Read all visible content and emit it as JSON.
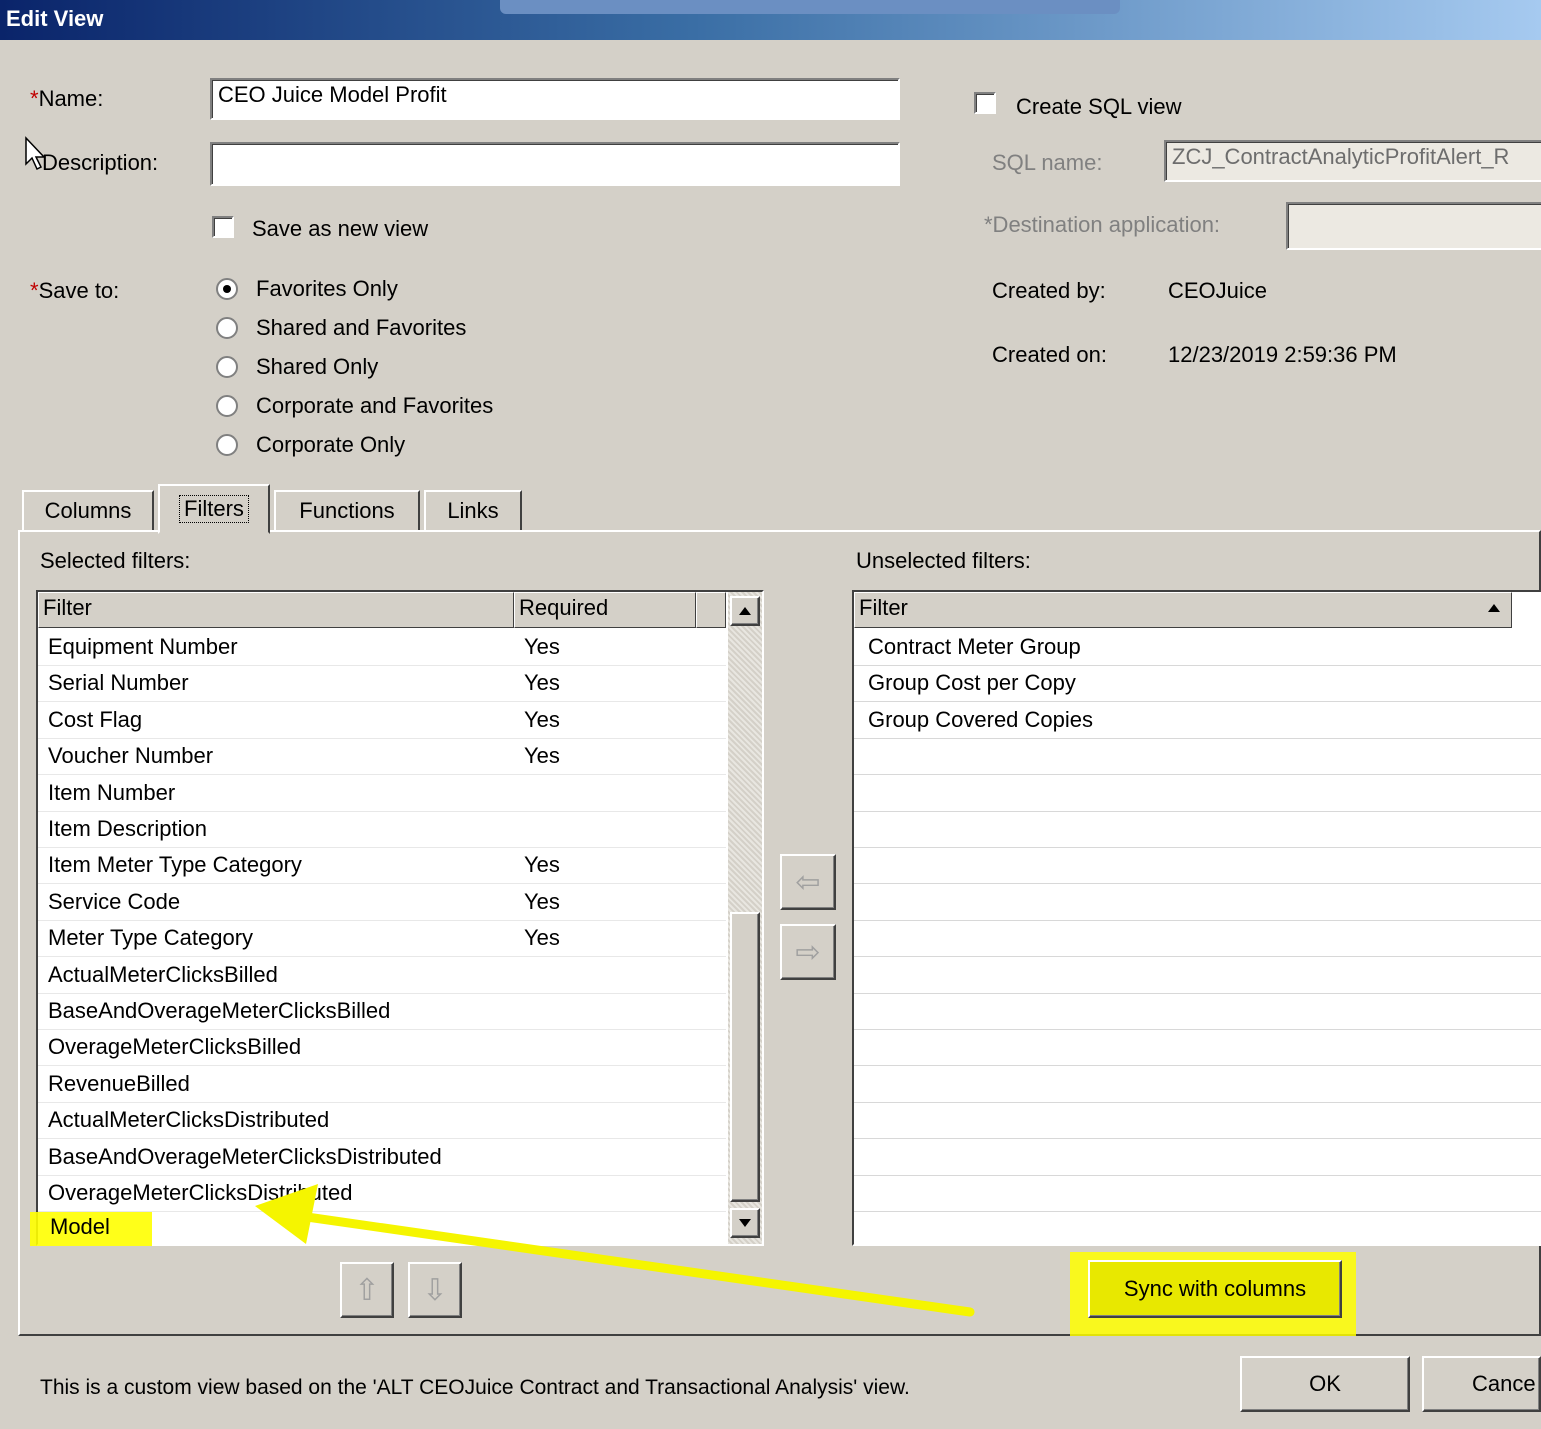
{
  "window": {
    "title": "Edit View"
  },
  "form": {
    "name_label": "Name:",
    "name_value": "CEO Juice Model Profit",
    "description_label": "Description:",
    "description_value": "",
    "save_as_new_label": "Save as new view",
    "save_to_label": "Save to:",
    "required_marker": "*",
    "save_to_options": [
      {
        "label": "Favorites Only",
        "selected": true
      },
      {
        "label": "Shared and Favorites",
        "selected": false
      },
      {
        "label": "Shared Only",
        "selected": false
      },
      {
        "label": "Corporate and Favorites",
        "selected": false
      },
      {
        "label": "Corporate Only",
        "selected": false
      }
    ]
  },
  "sql": {
    "create_label": "Create SQL view",
    "sql_name_label": "SQL name:",
    "sql_name_value": "ZCJ_ContractAnalyticProfitAlert_R",
    "dest_app_label": "*Destination application:",
    "dest_app_value": "",
    "created_by_label": "Created by:",
    "created_by_value": "CEOJuice",
    "created_on_label": "Created on:",
    "created_on_value": "12/23/2019 2:59:36 PM"
  },
  "tabs": [
    "Columns",
    "Filters",
    "Functions",
    "Links"
  ],
  "selected_filters": {
    "label": "Selected filters:",
    "columns": [
      "Filter",
      "Required"
    ],
    "rows": [
      [
        "Equipment Number",
        "Yes"
      ],
      [
        "Serial Number",
        "Yes"
      ],
      [
        "Cost Flag",
        "Yes"
      ],
      [
        "Voucher Number",
        "Yes"
      ],
      [
        "Item Number",
        ""
      ],
      [
        "Item Description",
        ""
      ],
      [
        "Item Meter Type Category",
        "Yes"
      ],
      [
        "Service Code",
        "Yes"
      ],
      [
        "Meter Type Category",
        "Yes"
      ],
      [
        "ActualMeterClicksBilled",
        ""
      ],
      [
        "BaseAndOverageMeterClicksBilled",
        ""
      ],
      [
        "OverageMeterClicksBilled",
        ""
      ],
      [
        "RevenueBilled",
        ""
      ],
      [
        "ActualMeterClicksDistributed",
        ""
      ],
      [
        "BaseAndOverageMeterClicksDistributed",
        ""
      ],
      [
        "OverageMeterClicksDistributed",
        ""
      ],
      [
        "Model",
        ""
      ]
    ]
  },
  "unselected_filters": {
    "label": "Unselected filters:",
    "column": "Filter",
    "rows": [
      "Contract Meter Group",
      "Group Cost per Copy",
      "Group Covered Copies"
    ]
  },
  "buttons": {
    "move_left": "⇦",
    "move_right": "⇨",
    "move_up": "⇧",
    "move_down": "⇩",
    "sync": "Sync with columns",
    "ok": "OK",
    "cancel": "Cance"
  },
  "status_text": "This is a custom view based on the 'ALT CEOJuice Contract and Transactional Analysis' view.",
  "colors": {
    "highlight": "#ffff00",
    "arrow": "#f5f500",
    "titlebar": "#0a246a"
  }
}
